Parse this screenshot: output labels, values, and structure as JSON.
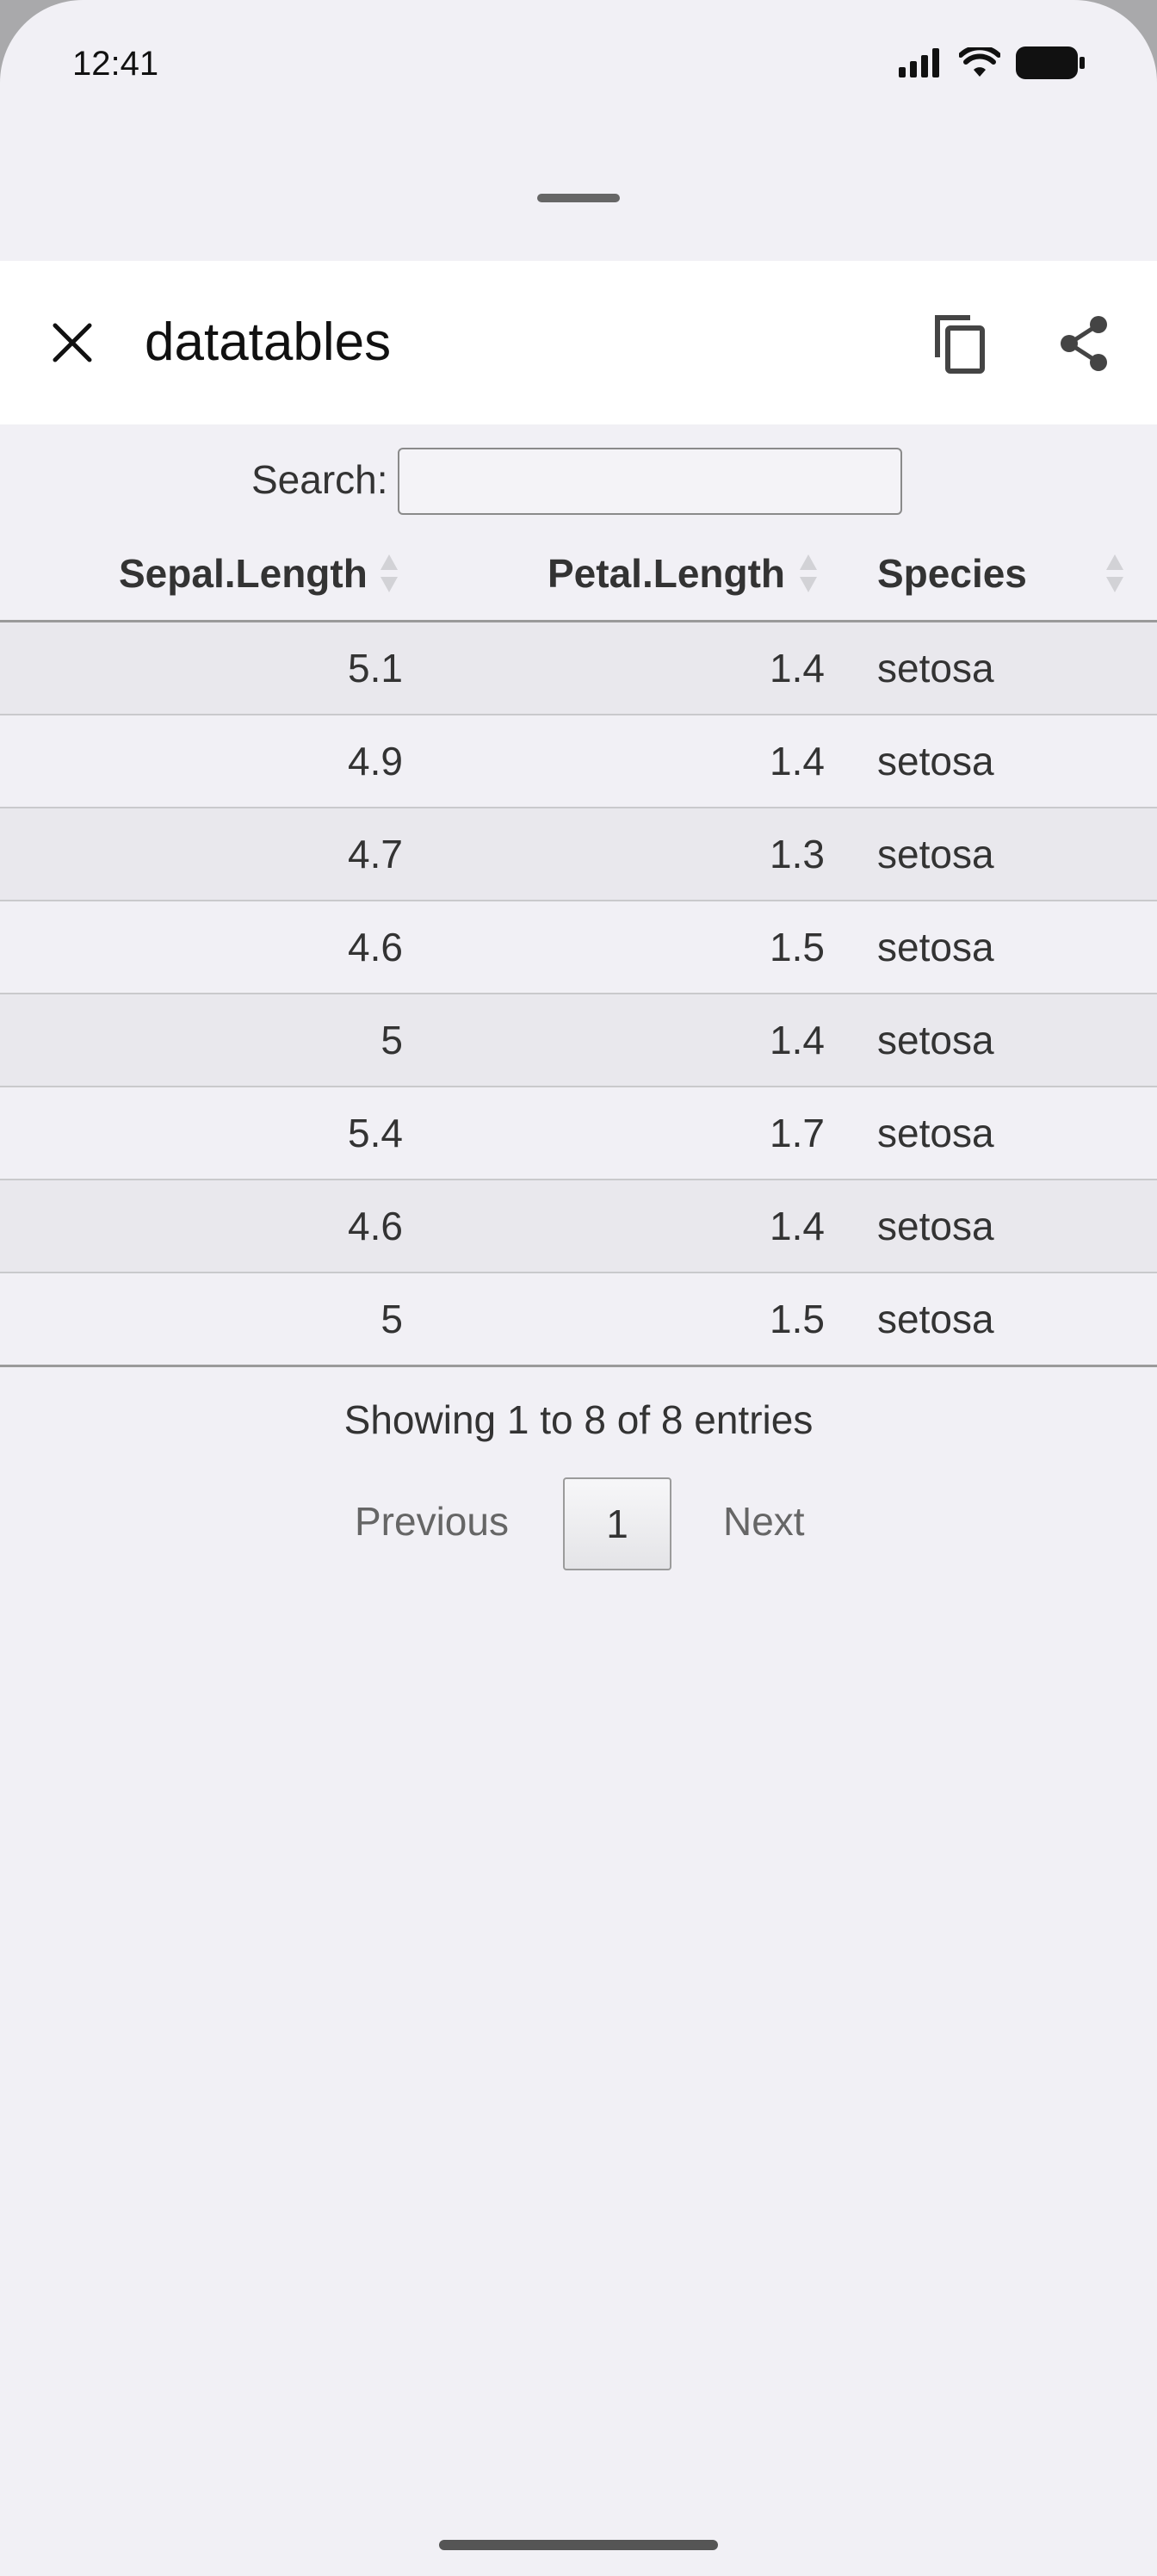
{
  "status_bar": {
    "time": "12:41"
  },
  "toolbar": {
    "title": "datatables"
  },
  "search": {
    "label": "Search:",
    "value": ""
  },
  "table": {
    "headers": [
      "Sepal.Length",
      "Petal.Length",
      "Species"
    ],
    "rows": [
      [
        "5.1",
        "1.4",
        "setosa"
      ],
      [
        "4.9",
        "1.4",
        "setosa"
      ],
      [
        "4.7",
        "1.3",
        "setosa"
      ],
      [
        "4.6",
        "1.5",
        "setosa"
      ],
      [
        "5",
        "1.4",
        "setosa"
      ],
      [
        "5.4",
        "1.7",
        "setosa"
      ],
      [
        "4.6",
        "1.4",
        "setosa"
      ],
      [
        "5",
        "1.5",
        "setosa"
      ]
    ]
  },
  "info": "Showing 1 to 8 of 8 entries",
  "pagination": {
    "previous": "Previous",
    "current_page": "1",
    "next": "Next"
  },
  "icons": [
    "signal-icon",
    "wifi-icon",
    "battery-icon",
    "close-icon",
    "copy-icon",
    "share-icon",
    "sort-icon"
  ]
}
